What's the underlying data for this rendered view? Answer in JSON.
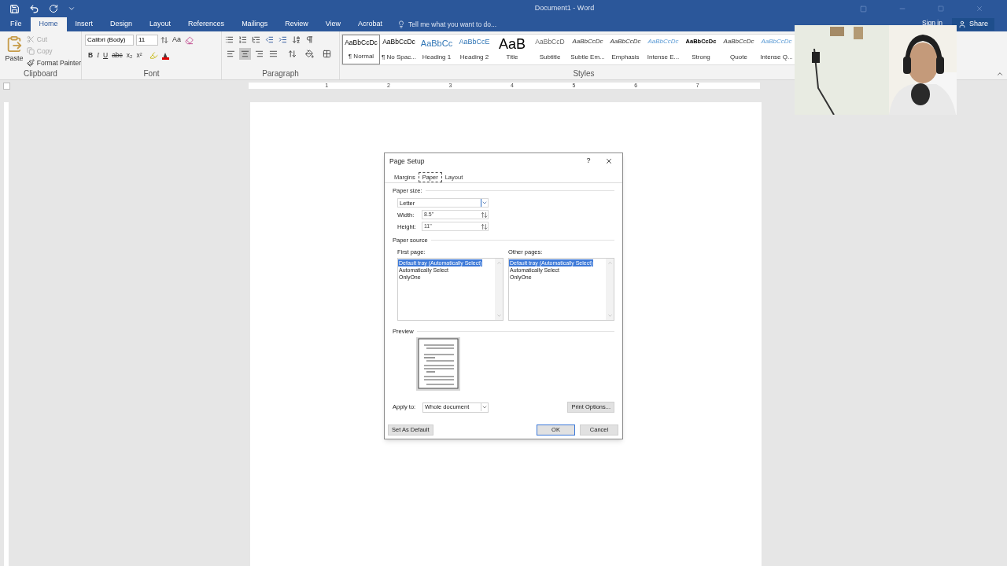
{
  "window": {
    "title": "Document1 - Word"
  },
  "ribbon_tabs": [
    {
      "label": "File",
      "selected": false
    },
    {
      "label": "Home",
      "selected": true
    },
    {
      "label": "Insert",
      "selected": false
    },
    {
      "label": "Design",
      "selected": false
    },
    {
      "label": "Layout",
      "selected": false
    },
    {
      "label": "References",
      "selected": false
    },
    {
      "label": "Mailings",
      "selected": false
    },
    {
      "label": "Review",
      "selected": false
    },
    {
      "label": "View",
      "selected": false
    },
    {
      "label": "Acrobat",
      "selected": false
    }
  ],
  "tell_me": {
    "placeholder": "Tell me what you want to do..."
  },
  "account": {
    "sign_in": "Sign in",
    "share": "Share"
  },
  "clipboard": {
    "paste": "Paste",
    "group_label": "Clipboard",
    "items": [
      {
        "label": "Cut",
        "disabled": true
      },
      {
        "label": "Copy",
        "disabled": true
      },
      {
        "label": "Format Painter",
        "disabled": false
      }
    ]
  },
  "font": {
    "name": "Calibri (Body)",
    "size": "11",
    "case_button": "Aa",
    "buttons": [
      "B",
      "I",
      "U",
      "abc",
      "x₂",
      "x²"
    ],
    "group_label": "Font"
  },
  "paragraph": {
    "group_label": "Paragraph",
    "alignments": [
      {
        "selected": false
      },
      {
        "selected": true
      },
      {
        "selected": false
      },
      {
        "selected": false
      }
    ]
  },
  "styles": {
    "group_label": "Styles",
    "items": [
      {
        "sample": "AaBbCcDc",
        "label": "¶ Normal",
        "kind": "body",
        "selected": true
      },
      {
        "sample": "AaBbCcDc",
        "label": "¶ No Spac...",
        "kind": "body",
        "selected": false
      },
      {
        "sample": "AaBbCc",
        "label": "Heading 1",
        "kind": "heading",
        "selected": false
      },
      {
        "sample": "AaBbCcE",
        "label": "Heading 2",
        "kind": "heading2",
        "selected": false
      },
      {
        "sample": "AaB",
        "label": "Title",
        "kind": "title",
        "selected": false
      },
      {
        "sample": "AaBbCcD",
        "label": "Subtitle",
        "kind": "subtle",
        "selected": false
      },
      {
        "sample": "AaBbCcDc",
        "label": "Subtle Em...",
        "kind": "emphasis",
        "selected": false
      },
      {
        "sample": "AaBbCcDc",
        "label": "Emphasis",
        "kind": "emphasis",
        "selected": false
      },
      {
        "sample": "AaBbCcDc",
        "label": "Intense E...",
        "kind": "intense",
        "selected": false
      },
      {
        "sample": "AaBbCcDc",
        "label": "Strong",
        "kind": "strong",
        "selected": false
      },
      {
        "sample": "AaBbCcDc",
        "label": "Quote",
        "kind": "emphasis",
        "selected": false
      },
      {
        "sample": "AaBbCcDc",
        "label": "Intense Q...",
        "kind": "intense",
        "selected": false
      }
    ]
  },
  "ruler": {
    "numbers": [
      "1",
      "2",
      "3",
      "4",
      "5",
      "6",
      "7"
    ]
  },
  "dialog": {
    "title": "Page Setup",
    "help": "?",
    "tabs": [
      {
        "label": "Margins",
        "selected": false
      },
      {
        "label": "Paper",
        "selected": true
      },
      {
        "label": "Layout",
        "selected": false
      }
    ],
    "paper_size": {
      "heading": "Paper size:",
      "value": "Letter",
      "width_label": "Width:",
      "width": "8.5\"",
      "height_label": "Height:",
      "height": "11\""
    },
    "paper_source": {
      "heading": "Paper source",
      "lists": [
        {
          "label": "First page:",
          "items": [
            {
              "label": "Default tray (Automatically Select)",
              "selected": true
            },
            {
              "label": "Automatically Select",
              "selected": false
            },
            {
              "label": "OnlyOne",
              "selected": false
            }
          ]
        },
        {
          "label": "Other pages:",
          "items": [
            {
              "label": "Default tray (Automatically Select)",
              "selected": true
            },
            {
              "label": "Automatically Select",
              "selected": false
            },
            {
              "label": "OnlyOne",
              "selected": false
            }
          ]
        }
      ]
    },
    "preview": {
      "heading": "Preview"
    },
    "apply_to": {
      "label": "Apply to:",
      "value": "Whole document"
    },
    "buttons": {
      "print_options": "Print Options...",
      "set_default": "Set As Default",
      "ok": "OK",
      "cancel": "Cancel"
    }
  }
}
